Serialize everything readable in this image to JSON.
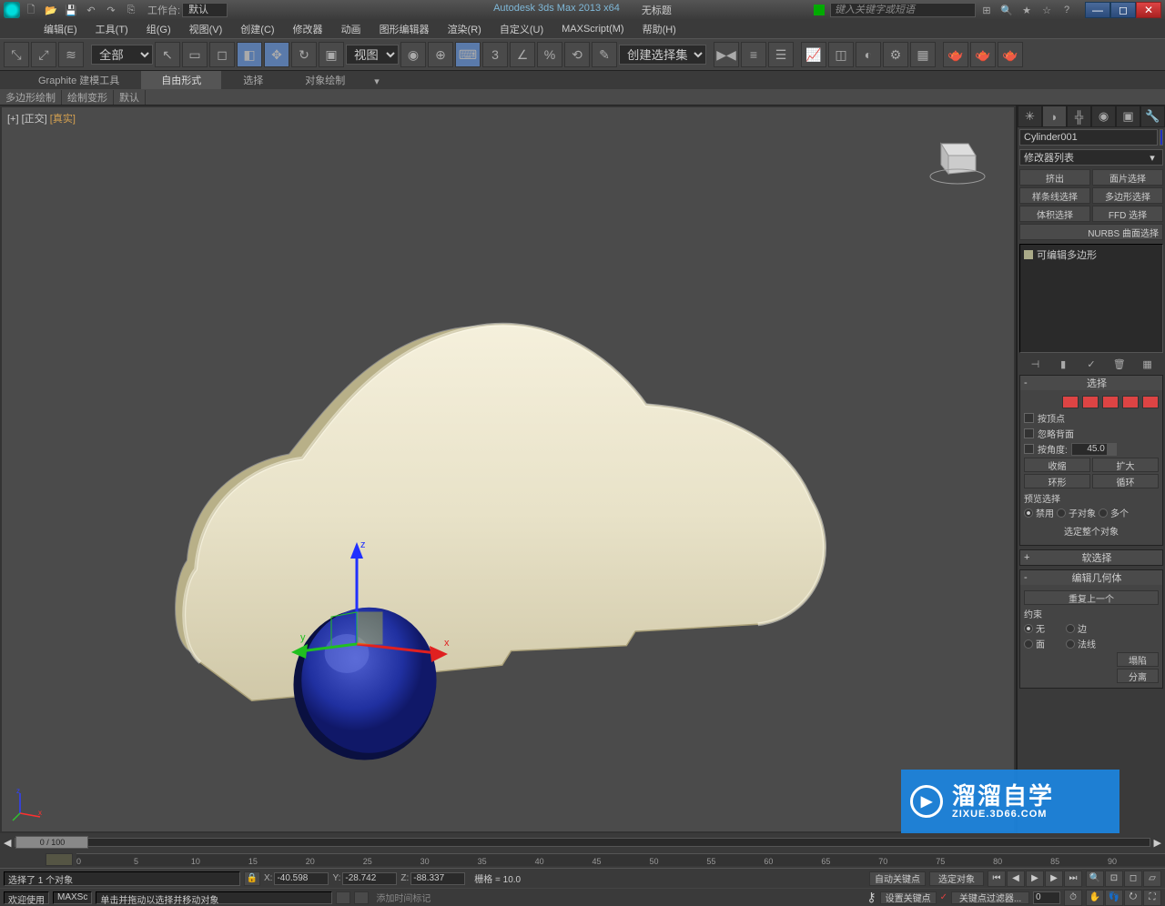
{
  "title_bar": {
    "workspace_label": "工作台:",
    "workspace_value": "默认",
    "app_title": "Autodesk 3ds Max  2013 x64",
    "doc_title": "无标题",
    "search_placeholder": "键入关键字或短语"
  },
  "menus": [
    "编辑(E)",
    "工具(T)",
    "组(G)",
    "视图(V)",
    "创建(C)",
    "修改器",
    "动画",
    "图形编辑器",
    "渲染(R)",
    "自定义(U)",
    "MAXScript(M)",
    "帮助(H)"
  ],
  "toolbar": {
    "filter_all": "全部",
    "ref_coord": "视图",
    "named_sel": "创建选择集"
  },
  "ribbon": {
    "tabs": [
      "Graphite 建模工具",
      "自由形式",
      "选择",
      "对象绘制"
    ],
    "active": 1,
    "sub_tabs": [
      "多边形绘制",
      "绘制变形",
      "默认"
    ]
  },
  "viewport": {
    "label_plus": "[+]",
    "label_view": "[正交]",
    "label_shade": "[真实]"
  },
  "cmd_panel": {
    "object_name": "Cylinder001",
    "modifier_list": "修改器列表",
    "mod_buttons": [
      "挤出",
      "面片选择",
      "样条线选择",
      "多边形选择",
      "体积选择",
      "FFD 选择",
      "NURBS 曲面选择"
    ],
    "stack_item": "可编辑多边形",
    "rollouts": {
      "selection": {
        "title": "选择",
        "by_vertex": "按顶点",
        "ignore_back": "忽略背面",
        "by_angle": "按角度:",
        "angle_val": "45.0",
        "shrink": "收缩",
        "grow": "扩大",
        "ring": "环形",
        "loop": "循环",
        "preview_label": "预览选择",
        "disable": "禁用",
        "subobj": "子对象",
        "multi": "多个",
        "sel_whole": "选定整个对象"
      },
      "soft_sel": {
        "title": "软选择"
      },
      "edit_geom": {
        "title": "编辑几何体",
        "repeat_last": "重复上一个",
        "constraints": "约束",
        "none": "无",
        "edge": "边",
        "face": "面",
        "normal": "法线",
        "collapse": "塌陷",
        "detach": "分离"
      }
    }
  },
  "timeline": {
    "slider_text": "0 / 100",
    "ticks": [
      0,
      5,
      10,
      15,
      20,
      25,
      30,
      35,
      40,
      45,
      50,
      55,
      60,
      65,
      70,
      75,
      80,
      85,
      90
    ]
  },
  "status": {
    "selection_prompt": "选择了 1 个对象",
    "x": "-40.598",
    "y": "-28.742",
    "z": "-88.337",
    "grid": "栅格 = 10.0",
    "auto_key": "自动关键点",
    "sel_frame": "选定对象",
    "welcome": "欢迎使用",
    "maxscript": "MAXSc",
    "tip": "单击并拖动以选择并移动对象",
    "add_time": "添加时间标记",
    "set_key": "设置关键点",
    "key_filter": "关键点过滤器..."
  },
  "watermark": {
    "big": "溜溜自学",
    "small": "ZIXUE.3D66.COM"
  }
}
